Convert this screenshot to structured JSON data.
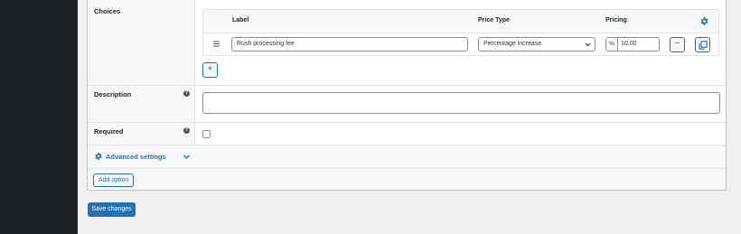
{
  "choices": {
    "label": "Choices",
    "columns": {
      "label": "Label",
      "price_type": "Price Type",
      "pricing": "Pricing"
    },
    "rows": [
      {
        "label": "Rush processing fee",
        "price_type": "Percentage increase",
        "pricing_prefix": "%",
        "pricing": "10.00"
      }
    ],
    "add_symbol": "+",
    "remove_symbol": "−"
  },
  "description": {
    "label": "Description",
    "help": "?",
    "value": ""
  },
  "required": {
    "label": "Required",
    "help": "?",
    "checked": false
  },
  "advanced": {
    "label": "Advanced settings"
  },
  "add_option_label": "Add option",
  "save_label": "Save changes",
  "colors": {
    "accent": "#2271b1",
    "sidebar": "#1d2327"
  }
}
